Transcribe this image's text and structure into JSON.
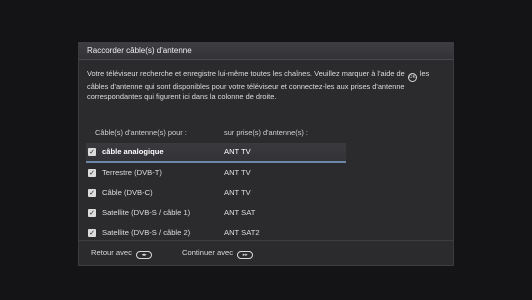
{
  "dialog": {
    "title": "Raccorder câble(s) d'antenne",
    "desc_part1": "Votre téléviseur recherche et enregistre lui-même toutes les chaînes. Veuillez marquer à l'aide de",
    "ok_icon_label": "OK",
    "desc_part2": "les câbles d'antenne qui sont disponibles pour votre téléviseur et connectez-les aux prises d'antenne correspondantes qui figurent ici dans la colonne de droite.",
    "col_cables": "Câble(s) d'antenne(s) pour :",
    "col_ports": "sur prise(s) d'antenne(s) :",
    "rows": [
      {
        "name": "câble analogique",
        "port": "ANT TV",
        "checked": true,
        "selected": true
      },
      {
        "name": "Terrestre (DVB-T)",
        "port": "ANT TV",
        "checked": true,
        "selected": false
      },
      {
        "name": "Câble (DVB-C)",
        "port": "ANT TV",
        "checked": true,
        "selected": false
      },
      {
        "name": "Satellite (DVB-S / câble 1)",
        "port": "ANT SAT",
        "checked": true,
        "selected": false
      },
      {
        "name": "Satellite (DVB-S / câble 2)",
        "port": "ANT SAT2",
        "checked": true,
        "selected": false
      }
    ],
    "footer": {
      "back_label": "Retour avec",
      "back_key_label": "◂▸",
      "continue_label": "Continuer avec",
      "continue_key_label": "▸▸"
    },
    "colors": {
      "selected_underline": "#6b88a8",
      "panel_bg": "#2b2b2e"
    }
  }
}
